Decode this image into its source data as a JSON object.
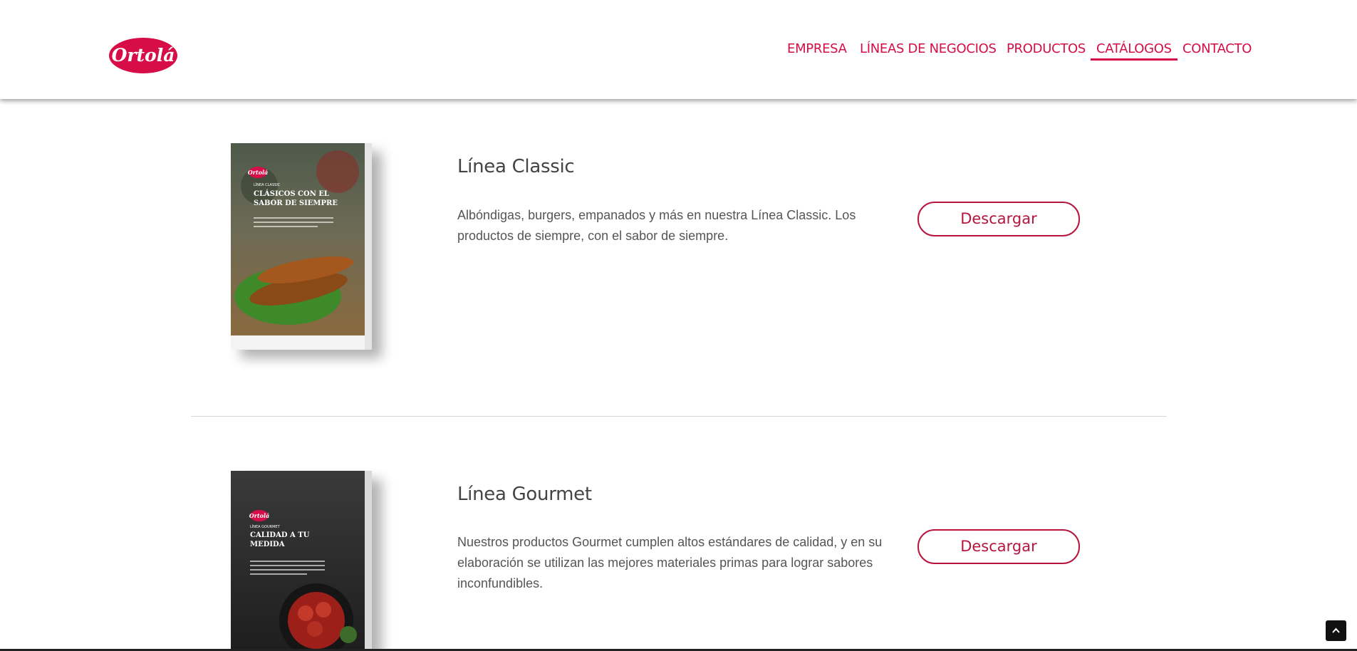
{
  "brand": {
    "logo_text": "Ortolá",
    "accent": "#d60d46",
    "button_color": "#b6153e"
  },
  "nav": {
    "items": [
      {
        "label": "EMPRESA"
      },
      {
        "label": "LÍNEAS DE NEGOCIOS"
      },
      {
        "label": "PRODUCTOS"
      },
      {
        "label": "CATÁLOGOS",
        "active": true
      },
      {
        "label": "CONTACTO"
      }
    ]
  },
  "catalogs": [
    {
      "title": "Línea Classic",
      "description": "Albóndigas, burgers, empanados y más en nuestra Línea Classic. Los productos de siempre, con el sabor de siempre.",
      "button_label": "Descargar",
      "cover": {
        "brand": "Ortolá",
        "line": "LÍNEA CLASSIC",
        "headline_1": "CLÁSICOS CON EL",
        "headline_2": "SABOR DE SIEMPRE"
      }
    },
    {
      "title": "Línea Gourmet",
      "description": "Nuestros productos Gourmet cumplen altos estándares de calidad, y en su elaboración se utilizan las mejores materiales primas para lograr sabores inconfundibles.",
      "button_label": "Descargar",
      "cover": {
        "brand": "Ortolá",
        "line": "LÍNEA GOURMET",
        "headline_1": "CALIDAD A TU",
        "headline_2": "MEDIDA"
      }
    }
  ],
  "icons": {
    "scroll_top": "chevron-up-icon"
  }
}
